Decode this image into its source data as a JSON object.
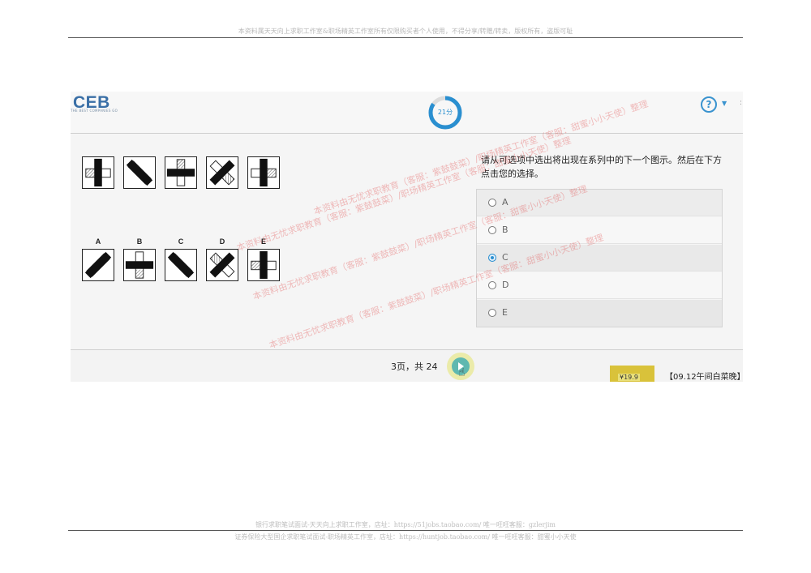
{
  "page": {
    "header_notice": "本资料属天天向上求职工作室&职场精英工作室所有仅限购买者个人使用，不得分享/转赠/转卖，版权所有，盗版可耻",
    "footer_line1": "银行求职笔试面试-天天向上求职工作室，店址：https://51jobs.taobao.com/ 唯一旺旺客服：gzlerjim",
    "footer_line2": "证券保险大型国企求职笔试面试-职场精英工作室，店址：https://huntjob.taobao.com/ 唯一旺旺客服：甜蜜小小天使"
  },
  "app": {
    "logo": "CEB",
    "logo_tagline": "THE BEST COMPANIES GO",
    "timer": "21分",
    "timer_progress": 0.85,
    "help_icon": "question-circle-icon"
  },
  "question": {
    "text": "请从可选项中选出将出现在系列中的下一个图示。然后在下方点击您的选择。",
    "options": [
      {
        "label": "A",
        "selected": false
      },
      {
        "label": "B",
        "selected": false
      },
      {
        "label": "C",
        "selected": true
      },
      {
        "label": "D",
        "selected": false
      },
      {
        "label": "E",
        "selected": false
      }
    ],
    "option_letters": [
      "A",
      "B",
      "C",
      "D",
      "E"
    ]
  },
  "footer": {
    "page_indicator": "3页，共 24",
    "ad_price": "¥19.9",
    "banner_text": "【09.12午间白菜晚】9"
  },
  "watermarks": [
    "本资料由无忧求职教育（客服：紫鼓鼓菜）/职场精英工作室（客服：甜蜜小小天使）整理",
    "本资料由无忧求职教育（客服：紫鼓鼓菜）/职场精英工作室（客服：甜蜜小小天使）整理",
    "本资料由无忧求职教育（客服：紫鼓鼓菜）/职场精英工作室（客服：甜蜜小小天使）整理",
    "本资料由无忧求职教育（客服：紫鼓鼓菜）/职场精英工作室（客服：甜蜜小小天使）整理"
  ],
  "colors": {
    "accent": "#2a8fd0",
    "logo": "#3a6fa6",
    "selected_row": "#eaeaea"
  }
}
